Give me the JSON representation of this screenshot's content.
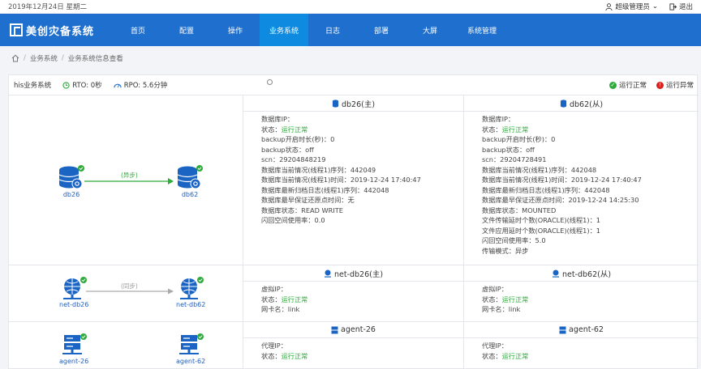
{
  "topbar": {
    "date": "2019年12月24日 星期二",
    "user": "超级管理员",
    "logout": "退出"
  },
  "brand": "美创灾备系统",
  "menu": [
    "首页",
    "配置",
    "操作",
    "业务系统",
    "日志",
    "部署",
    "大屏",
    "系统管理"
  ],
  "breadcrumb": [
    "业务系统",
    "业务系统信息查看"
  ],
  "header": {
    "system": "his业务系统",
    "rto": "RTO: 0秒",
    "rpo": "RPO: 5.6分钟",
    "legend_ok": "运行正常",
    "legend_err": "运行异常"
  },
  "row1": {
    "edge": "(异步)",
    "left_node": "db26",
    "right_node": "db62",
    "primary": {
      "title": "db26(主)",
      "lines": [
        {
          "k": "数据库IP：",
          "v": ""
        },
        {
          "k": "状态：",
          "v": "运行正常",
          "ok": true
        },
        {
          "k": "backup开启时长(秒)：",
          "v": "0"
        },
        {
          "k": "backup状态：",
          "v": "off"
        },
        {
          "k": "scn：",
          "v": "29204848219"
        },
        {
          "k": "数据库当前情况(线程1)序列：",
          "v": "442049"
        },
        {
          "k": "数据库当前情况(线程1)时间：",
          "v": "2019-12-24 17:40:47"
        },
        {
          "k": "数据库最新归档日志(线程1)序列：",
          "v": "442048"
        },
        {
          "k": "数据库最早保证还原点时间：",
          "v": "无"
        },
        {
          "k": "数据库状态：",
          "v": "READ WRITE"
        },
        {
          "k": "闪回空间使用率：",
          "v": "0.0"
        }
      ]
    },
    "standby": {
      "title": "db62(从)",
      "lines": [
        {
          "k": "数据库IP：",
          "v": ""
        },
        {
          "k": "状态：",
          "v": "运行正常",
          "ok": true
        },
        {
          "k": "backup开启时长(秒)：",
          "v": "0"
        },
        {
          "k": "backup状态：",
          "v": "off"
        },
        {
          "k": "scn：",
          "v": "29204728491"
        },
        {
          "k": "数据库当前情况(线程1)序列：",
          "v": "442048"
        },
        {
          "k": "数据库当前情况(线程1)时间：",
          "v": "2019-12-24 17:40:47"
        },
        {
          "k": "数据库最新归档日志(线程1)序列：",
          "v": "442048"
        },
        {
          "k": "数据库最早保证还原点时间：",
          "v": "2019-12-24 14:25:30"
        },
        {
          "k": "数据库状态：",
          "v": "MOUNTED"
        },
        {
          "k": "文件传输延时个数(ORACLE)(线程1)：",
          "v": "1"
        },
        {
          "k": "文件应用延时个数(ORACLE)(线程1)：",
          "v": "1"
        },
        {
          "k": "闪回空间使用率：",
          "v": "5.0"
        },
        {
          "k": "传输模式：",
          "v": "异步"
        }
      ]
    }
  },
  "row2": {
    "edge": "(同步)",
    "left_node": "net-db26",
    "right_node": "net-db62",
    "primary": {
      "title": "net-db26(主)",
      "lines": [
        {
          "k": "虚拟IP：",
          "v": ""
        },
        {
          "k": "状态：",
          "v": "运行正常",
          "ok": true
        },
        {
          "k": "网卡名：",
          "v": "link"
        }
      ]
    },
    "standby": {
      "title": "net-db62(从)",
      "lines": [
        {
          "k": "虚拟IP：",
          "v": ""
        },
        {
          "k": "状态：",
          "v": "运行正常",
          "ok": true
        },
        {
          "k": "网卡名：",
          "v": "link"
        }
      ]
    }
  },
  "row3": {
    "left_node": "agent-26",
    "right_node": "agent-62",
    "primary": {
      "title": "agent-26",
      "lines": [
        {
          "k": "代理IP：",
          "v": ""
        },
        {
          "k": "状态：",
          "v": "运行正常",
          "ok": true
        }
      ]
    },
    "standby": {
      "title": "agent-62",
      "lines": [
        {
          "k": "代理IP：",
          "v": ""
        },
        {
          "k": "状态：",
          "v": "运行正常",
          "ok": true
        }
      ]
    }
  }
}
